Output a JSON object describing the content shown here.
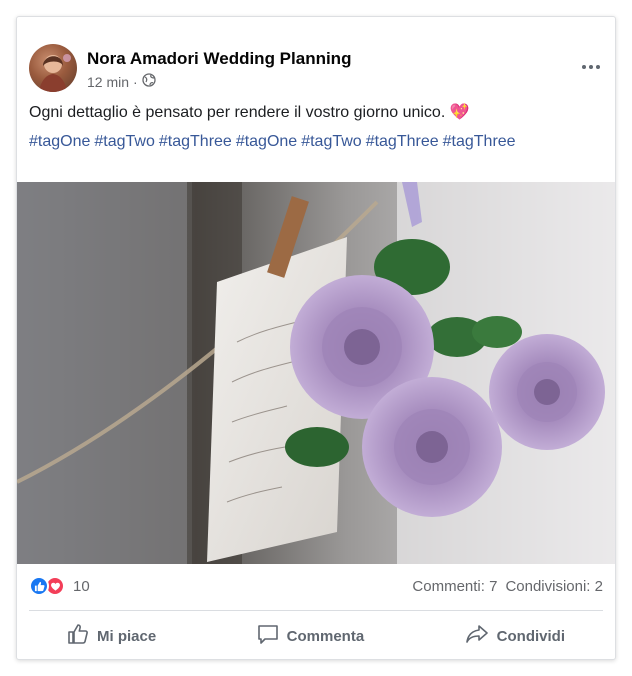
{
  "post": {
    "author": "Nora Amadori Wedding Planning",
    "time": "12 min",
    "separator": "·",
    "audience_icon": "globe-icon",
    "text": "Ogni dettaglio è pensato per rendere il vostro giorno unico. 💖",
    "hashtags": [
      "#tagOne",
      "#tagTwo",
      "#tagThree",
      "#tagOne",
      "#tagTwo",
      "#tagThree",
      "#tagThree"
    ]
  },
  "reactions": {
    "count": "10",
    "comments": "Commenti: 7",
    "shares": "Condivisioni: 2"
  },
  "actions": {
    "like_label": "Mi piace",
    "comment_label": "Commenta",
    "share_label": "Condividi"
  },
  "colors": {
    "link": "#385898",
    "like_blue": "#1877f2",
    "love_red": "#f33e58",
    "muted": "#65676b"
  }
}
